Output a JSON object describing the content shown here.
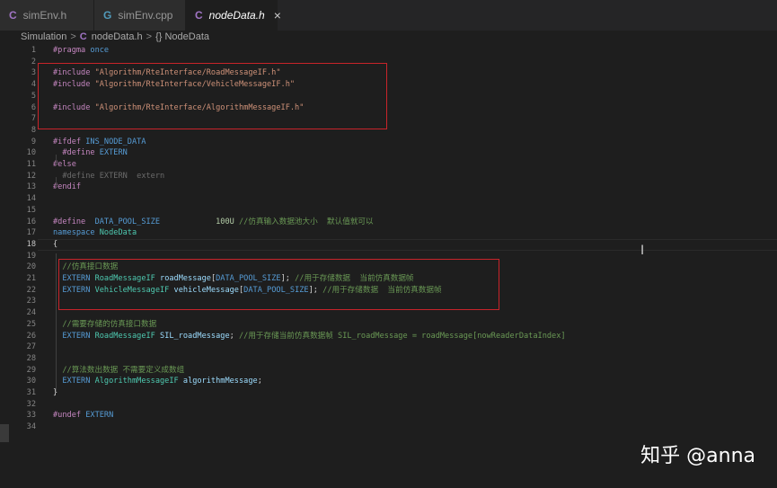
{
  "tabs": [
    {
      "icon": "C",
      "label": "simEnv.h"
    },
    {
      "icon": "G",
      "label": "simEnv.cpp"
    },
    {
      "icon": "C",
      "label": "nodeData.h",
      "close": "×"
    }
  ],
  "breadcrumb": {
    "folder": "Simulation",
    "sep": ">",
    "file_icon": "C",
    "file": "nodeData.h",
    "symbol": "{} NodeData"
  },
  "editor": {
    "current_line": "18",
    "lines": [
      {
        "n": "1",
        "p": [
          [
            "pp",
            "#pragma "
          ],
          [
            "kw",
            "once"
          ]
        ]
      },
      {
        "n": "2",
        "p": []
      },
      {
        "n": "3",
        "p": [
          [
            "pp",
            "#include "
          ],
          [
            "str",
            "\"Algorithm/RteInterface/RoadMessageIF.h\""
          ]
        ]
      },
      {
        "n": "4",
        "p": [
          [
            "pp",
            "#include "
          ],
          [
            "str",
            "\"Algorithm/RteInterface/VehicleMessageIF.h\""
          ]
        ]
      },
      {
        "n": "5",
        "p": []
      },
      {
        "n": "6",
        "p": [
          [
            "pp",
            "#include "
          ],
          [
            "str",
            "\"Algorithm/RteInterface/AlgorithmMessageIF.h\""
          ]
        ]
      },
      {
        "n": "7",
        "p": []
      },
      {
        "n": "8",
        "p": []
      },
      {
        "n": "9",
        "p": [
          [
            "pp",
            "#ifdef "
          ],
          [
            "kw",
            "INS_NODE_DATA"
          ]
        ]
      },
      {
        "n": "10",
        "p": [
          [
            "txt",
            "  "
          ],
          [
            "pp",
            "#define "
          ],
          [
            "kw",
            "EXTERN"
          ]
        ]
      },
      {
        "n": "11",
        "p": [
          [
            "pp",
            "#else"
          ]
        ]
      },
      {
        "n": "12",
        "p": [
          [
            "txt",
            "  "
          ],
          [
            "dim",
            "#define EXTERN  extern"
          ]
        ]
      },
      {
        "n": "13",
        "p": [
          [
            "pp",
            "#endif"
          ]
        ]
      },
      {
        "n": "14",
        "p": []
      },
      {
        "n": "15",
        "p": []
      },
      {
        "n": "16",
        "p": [
          [
            "pp",
            "#define  "
          ],
          [
            "kw",
            "DATA_POOL_SIZE"
          ],
          [
            "txt",
            "            "
          ],
          [
            "num",
            "100U"
          ],
          [
            "txt",
            " "
          ],
          [
            "cm",
            "//仿真输入数据池大小  默认值就可以"
          ]
        ]
      },
      {
        "n": "17",
        "p": [
          [
            "kw",
            "namespace "
          ],
          [
            "ty",
            "NodeData"
          ]
        ]
      },
      {
        "n": "18",
        "p": [
          [
            "txt",
            "{"
          ]
        ]
      },
      {
        "n": "19",
        "p": []
      },
      {
        "n": "20",
        "p": [
          [
            "txt",
            "  "
          ],
          [
            "cm",
            "//仿真接口数据"
          ]
        ]
      },
      {
        "n": "21",
        "p": [
          [
            "txt",
            "  "
          ],
          [
            "kw",
            "EXTERN "
          ],
          [
            "ty",
            "RoadMessageIF "
          ],
          [
            "var",
            "roadMessage"
          ],
          [
            "txt",
            "["
          ],
          [
            "kw",
            "DATA_POOL_SIZE"
          ],
          [
            "txt",
            "]; "
          ],
          [
            "cm",
            "//用于存储数据  当前仿真数据帧"
          ]
        ]
      },
      {
        "n": "22",
        "p": [
          [
            "txt",
            "  "
          ],
          [
            "kw",
            "EXTERN "
          ],
          [
            "ty",
            "VehicleMessageIF "
          ],
          [
            "var",
            "vehicleMessage"
          ],
          [
            "txt",
            "["
          ],
          [
            "kw",
            "DATA_POOL_SIZE"
          ],
          [
            "txt",
            "]; "
          ],
          [
            "cm",
            "//用于存储数据  当前仿真数据帧"
          ]
        ]
      },
      {
        "n": "23",
        "p": []
      },
      {
        "n": "24",
        "p": []
      },
      {
        "n": "25",
        "p": [
          [
            "txt",
            "  "
          ],
          [
            "cm",
            "//需要存储的仿真接口数据"
          ]
        ]
      },
      {
        "n": "26",
        "p": [
          [
            "txt",
            "  "
          ],
          [
            "kw",
            "EXTERN "
          ],
          [
            "ty",
            "RoadMessageIF "
          ],
          [
            "var",
            "SIL_roadMessage"
          ],
          [
            "txt",
            "; "
          ],
          [
            "cm",
            "//用于存储当前仿真数据帧 SIL_roadMessage = roadMessage[nowReaderDataIndex]"
          ]
        ]
      },
      {
        "n": "27",
        "p": []
      },
      {
        "n": "28",
        "p": []
      },
      {
        "n": "29",
        "p": [
          [
            "txt",
            "  "
          ],
          [
            "cm",
            "//算法数出数据 不需要定义成数组"
          ]
        ]
      },
      {
        "n": "30",
        "p": [
          [
            "txt",
            "  "
          ],
          [
            "kw",
            "EXTERN "
          ],
          [
            "ty",
            "AlgorithmMessageIF "
          ],
          [
            "var",
            "algorithmMessage"
          ],
          [
            "txt",
            ";"
          ]
        ]
      },
      {
        "n": "31",
        "p": [
          [
            "txt",
            "}"
          ]
        ]
      },
      {
        "n": "32",
        "p": []
      },
      {
        "n": "33",
        "p": [
          [
            "pp",
            "#undef "
          ],
          [
            "kw",
            "EXTERN"
          ]
        ]
      },
      {
        "n": "34",
        "p": []
      }
    ]
  },
  "watermark": "知乎 @anna",
  "colors": {
    "background": "#1e1e1e",
    "annotation_box": "#c8242a"
  }
}
